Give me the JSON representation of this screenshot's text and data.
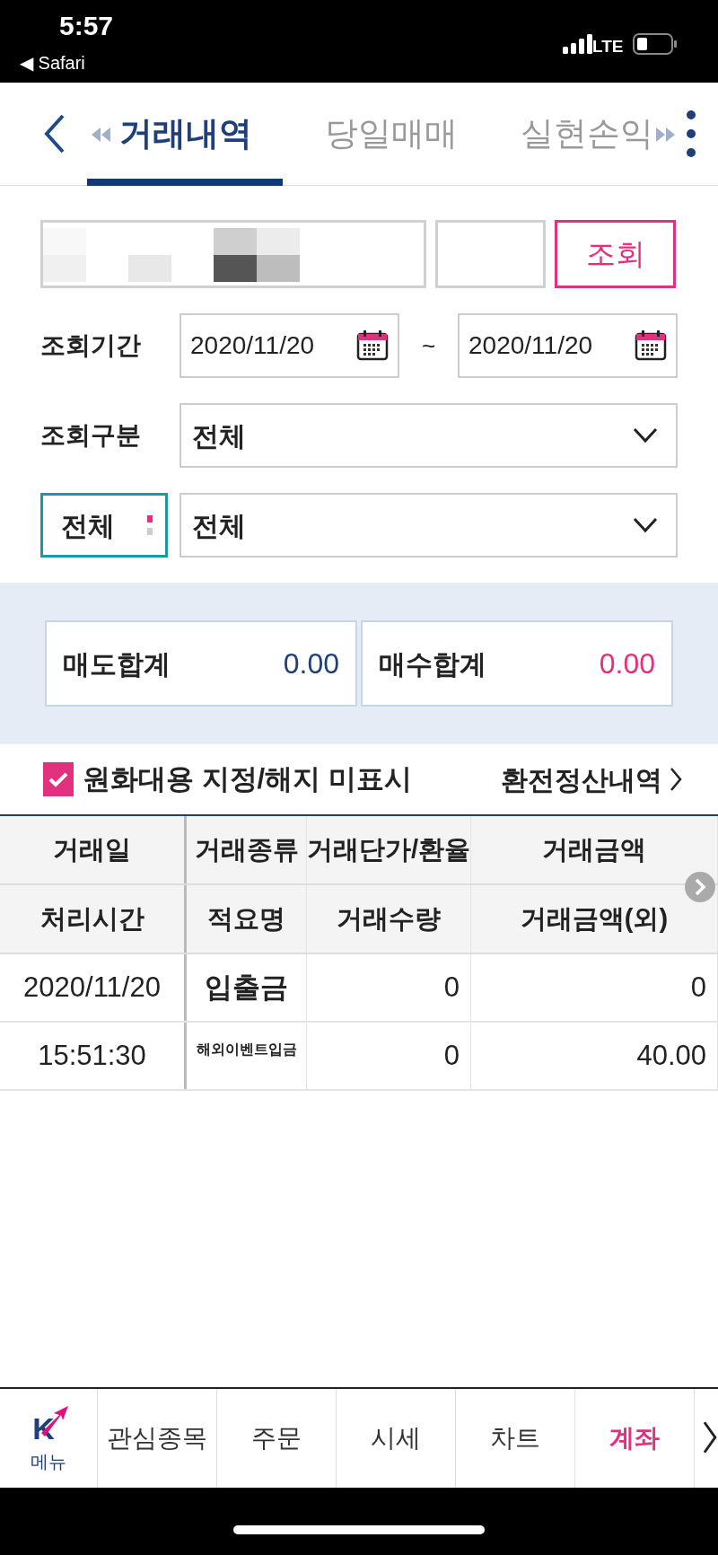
{
  "status_bar": {
    "time": "5:57",
    "back_app": "◀ Safari",
    "network": "LTE"
  },
  "header": {
    "tabs": [
      {
        "label": "거래내역",
        "selected": true
      },
      {
        "label": "당일매매",
        "selected": false
      },
      {
        "label": "실현손익",
        "selected": false
      }
    ]
  },
  "form": {
    "search_button": "조회",
    "period_label": "조회기간",
    "start_date": "2020/11/20",
    "separator": "~",
    "end_date": "2020/11/20",
    "type_label": "조회구분",
    "type_value": "전체",
    "filter_button": "전체",
    "filter_value": "전체"
  },
  "summary": [
    {
      "kind": "sell",
      "label": "매도합계",
      "value": "0.00"
    },
    {
      "kind": "buy",
      "label": "매수합계",
      "value": "0.00"
    }
  ],
  "option": {
    "label": "원화대용 지정/해지 미표시",
    "checked": true
  },
  "link": "환전정산내역",
  "table": {
    "header_rows": [
      [
        "거래일",
        "거래종류",
        "거래단가/환율",
        "거래금액"
      ],
      [
        "처리시간",
        "적요명",
        "거래수량",
        "거래금액(외)"
      ]
    ],
    "rows": [
      [
        "2020/11/20",
        "입출금",
        "0",
        "0"
      ],
      [
        "15:51:30",
        "해외이벤트입금",
        "0",
        "40.00"
      ]
    ]
  },
  "bottom_nav": {
    "logo_text": "K",
    "menu_label": "메뉴",
    "items": [
      {
        "label": "관심종목",
        "selected": false
      },
      {
        "label": "주문",
        "selected": false
      },
      {
        "label": "시세",
        "selected": false
      },
      {
        "label": "차트",
        "selected": false
      },
      {
        "label": "계좌",
        "selected": true
      }
    ]
  }
}
